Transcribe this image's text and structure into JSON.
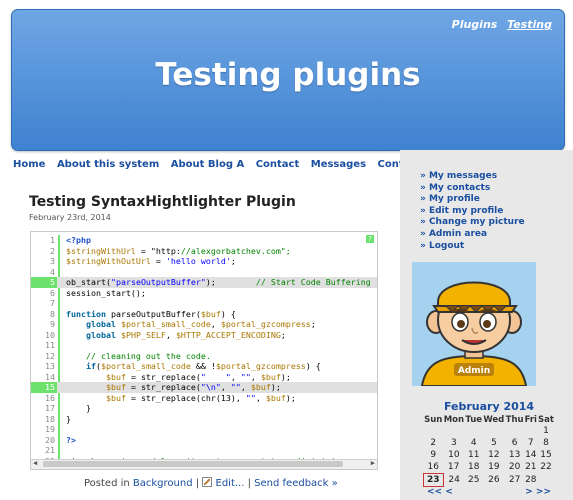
{
  "header": {
    "site_title": "Testing plugins",
    "top_links": [
      "Plugins",
      "Testing"
    ]
  },
  "main_nav": [
    "Home",
    "About this system",
    "About Blog A",
    "Contact",
    "Messages",
    "Contacts"
  ],
  "post": {
    "title": "Testing SyntaxHightlighter Plugin",
    "date": "February 23rd, 2014",
    "code_lines": [
      "<?php",
      "$stringWithUrl = \"http://alexgorbatchev.com\";",
      "$stringWithOutUrl = 'hello world';",
      "",
      "ob_start(\"parseOutputBuffer\");        // Start Code Buffering",
      "session_start();",
      "",
      "function parseOutputBuffer($buf) {",
      "    global $portal_small_code, $portal_gzcompress;",
      "    global $PHP_SELF, $HTTP_ACCEPT_ENCODING;",
      "",
      "    // cleaning out the code.",
      "    if($portal_small_code && !$portal_gzcompress) {",
      "        $buf = str_replace(\"    \", \"\", $buf);",
      "        $buf = str_replace(\"\\n\", \"\", $buf);",
      "        $buf = str_replace(chr(13), \"\", $buf);",
      "    }",
      "}",
      "",
      "?>",
      "",
      "<!-- Lorem ipsum dolor sit amet, consectetur adipisicing"
    ],
    "highlighted_lines": [
      5,
      15
    ],
    "footer": {
      "posted_in": "Posted in",
      "category": "Background",
      "edit": "Edit...",
      "sep": "|",
      "feedback": "Send feedback »"
    }
  },
  "sidebar": {
    "user_menu": [
      "My messages",
      "My contacts",
      "My profile",
      "Edit my profile",
      "Change my picture",
      "Admin area",
      "Logout"
    ],
    "avatar_label": "Admin",
    "calendar": {
      "month": "February 2014",
      "weekdays": [
        "Sun",
        "Mon",
        "Tue",
        "Wed",
        "Thu",
        "Fri",
        "Sat"
      ],
      "weeks": [
        [
          "",
          "",
          "",
          "",
          "",
          "",
          "1"
        ],
        [
          "2",
          "3",
          "4",
          "5",
          "6",
          "7",
          "8"
        ],
        [
          "9",
          "10",
          "11",
          "12",
          "13",
          "14",
          "15"
        ],
        [
          "16",
          "17",
          "18",
          "19",
          "20",
          "21",
          "22"
        ],
        [
          "23",
          "24",
          "25",
          "26",
          "27",
          "28",
          ""
        ]
      ],
      "today": "23",
      "nav_prev": "<< <",
      "nav_next": "> >>"
    }
  },
  "colors": {
    "header_bg": "#4f8fd9",
    "link": "#1a4fa0",
    "code_highlight": "#6ce26c"
  }
}
